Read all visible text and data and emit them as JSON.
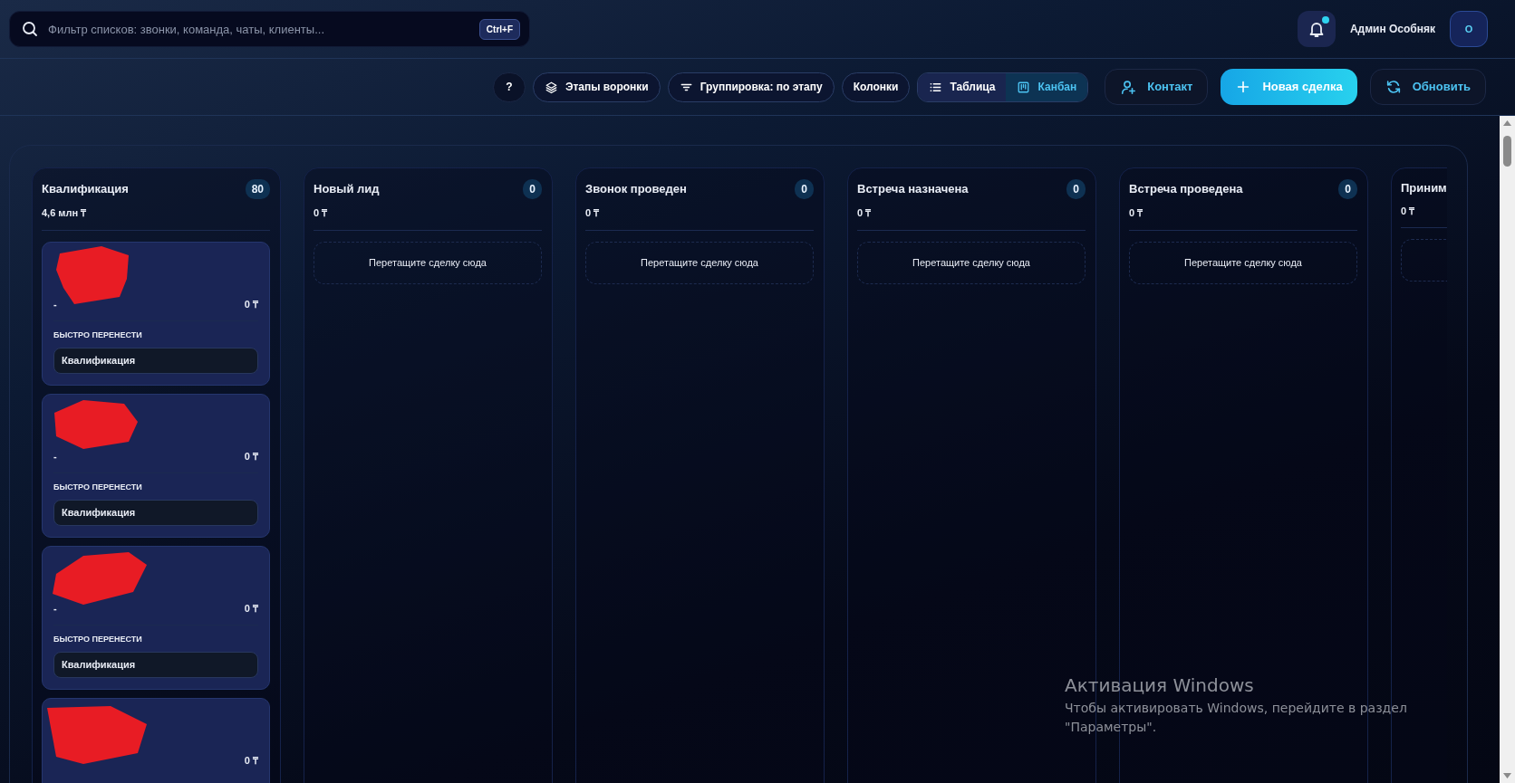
{
  "search": {
    "placeholder": "Фильтр списков: звонки, команда, чаты, клиенты...",
    "shortcut": "Ctrl+F"
  },
  "user": {
    "name": "Админ Особняк",
    "initial": "О",
    "has_notifications": true
  },
  "toolbar": [
    {
      "kind": "help",
      "label": "?"
    },
    {
      "kind": "stages",
      "label": "Этапы воронки"
    },
    {
      "kind": "grouping",
      "label": "Группировка: по этапу"
    },
    {
      "kind": "columns",
      "label": "Колонки"
    }
  ],
  "views": [
    {
      "kind": "table",
      "label": "Таблица",
      "selected": false
    },
    {
      "kind": "kanban",
      "label": "Канбан",
      "selected": true
    }
  ],
  "actions": [
    {
      "kind": "contact",
      "label": "Контакт"
    },
    {
      "kind": "new",
      "label": "Новая сделка"
    },
    {
      "kind": "refresh",
      "label": "Обновить"
    }
  ],
  "columns": [
    {
      "title": "Квалификация",
      "count": "80",
      "sum": "4,6 млн ₸",
      "cards": [
        {
          "redacted": true,
          "left": "-",
          "amount": "0 ₸",
          "move_label": "БЫСТРО ПЕРЕНЕСТИ",
          "stage": "Квалификация"
        },
        {
          "redacted": true,
          "left": "-",
          "amount": "0 ₸",
          "move_label": "БЫСТРО ПЕРЕНЕСТИ",
          "stage": "Квалификация"
        },
        {
          "redacted": true,
          "left": "-",
          "amount": "0 ₸",
          "move_label": "БЫСТРО ПЕРЕНЕСТИ",
          "stage": "Квалификация"
        },
        {
          "redacted": true,
          "amount": "0 ₸"
        }
      ]
    },
    {
      "title": "Новый лид",
      "count": "0",
      "sum": "0 ₸",
      "dropzone": "Перетащите сделку сюда"
    },
    {
      "title": "Звонок проведен",
      "count": "0",
      "sum": "0 ₸",
      "dropzone": "Перетащите сделку сюда"
    },
    {
      "title": "Встреча назначена",
      "count": "0",
      "sum": "0 ₸",
      "dropzone": "Перетащите сделку сюда"
    },
    {
      "title": "Встреча проведена",
      "count": "0",
      "sum": "0 ₸",
      "dropzone": "Перетащите сделку сюда"
    },
    {
      "title": "Приним",
      "sum": "0 ₸"
    }
  ],
  "os_notice": {
    "title": "Активация Windows",
    "text": "Чтобы активировать Windows, перейдите в раздел \"Параметры\"."
  }
}
